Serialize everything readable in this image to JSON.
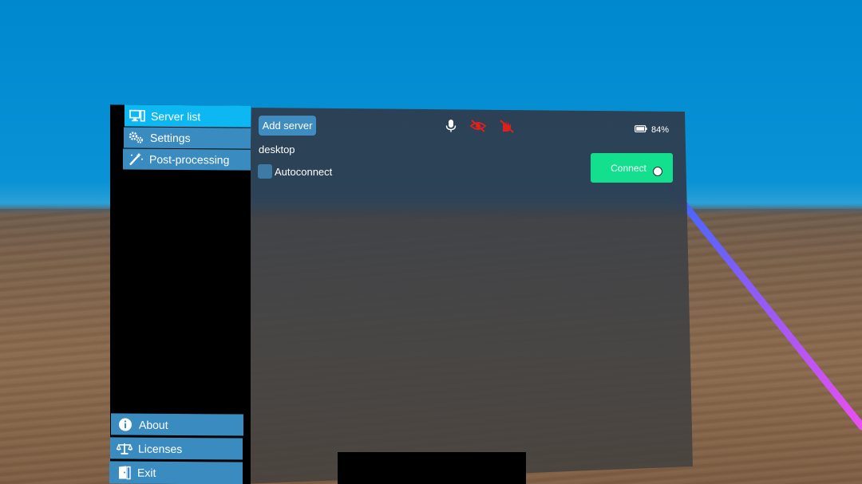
{
  "sidebar": {
    "top_items": [
      {
        "label": "Server list",
        "icon": "monitor-icon",
        "active": true
      },
      {
        "label": "Settings",
        "icon": "gears-icon",
        "active": false
      },
      {
        "label": "Post-processing",
        "icon": "magic-wand-icon",
        "active": false
      }
    ],
    "bottom_items": [
      {
        "label": "About",
        "icon": "info-icon"
      },
      {
        "label": "Licenses",
        "icon": "scales-icon"
      },
      {
        "label": "Exit",
        "icon": "exit-door-icon"
      }
    ]
  },
  "toolbar": {
    "add_server_label": "Add server",
    "status_icons": [
      "microphone-icon",
      "eye-tracking-off-icon",
      "hand-tracking-off-icon"
    ],
    "battery_text": "84%"
  },
  "server": {
    "name": "desktop",
    "autoconnect_label": "Autoconnect",
    "autoconnect_checked": false,
    "connect_label": "Connect"
  },
  "colors": {
    "active_nav": "#0db8f2",
    "nav": "#3a8cc0",
    "connect": "#12e08f",
    "status_off": "#e0201b"
  }
}
